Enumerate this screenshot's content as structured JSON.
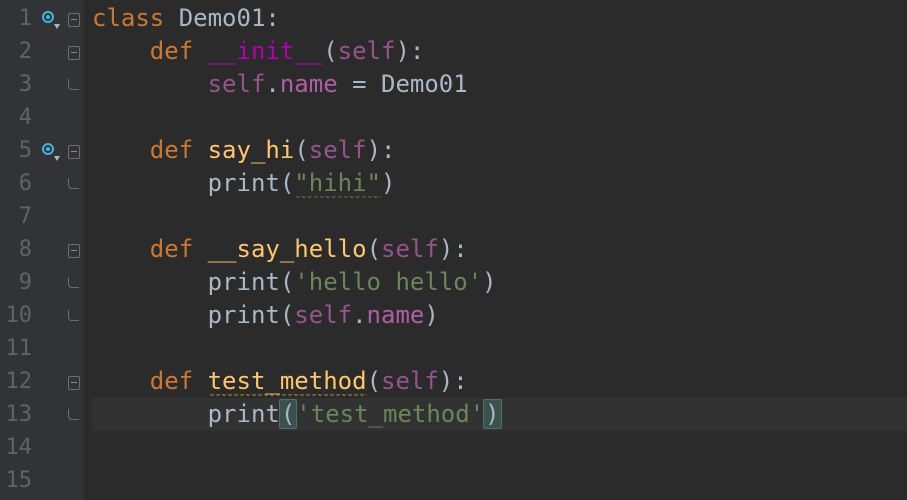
{
  "gutter": {
    "numbers": [
      "1",
      "2",
      "3",
      "4",
      "5",
      "6",
      "7",
      "8",
      "9",
      "10",
      "11",
      "12",
      "13",
      "14",
      "15"
    ],
    "override_lines": [
      1,
      5
    ],
    "fold_minus_lines": [
      1,
      2,
      5,
      8,
      12
    ],
    "fold_end_lines": [
      3,
      6,
      9,
      10,
      13
    ]
  },
  "code": {
    "l1": {
      "kw": "class",
      "cls": "Demo01",
      "colon": ":"
    },
    "l2": {
      "kw": "def",
      "name": "__init__",
      "lp": "(",
      "self": "self",
      "rp": ")",
      "colon": ":"
    },
    "l3": {
      "self": "self",
      "dot": ".",
      "attr": "name",
      "eq": " = ",
      "val": "Demo01"
    },
    "l5": {
      "kw": "def",
      "name": "say_hi",
      "lp": "(",
      "self": "self",
      "rp": ")",
      "colon": ":"
    },
    "l6": {
      "call": "print",
      "lp": "(",
      "str": "\"hihi\"",
      "rp": ")"
    },
    "l8": {
      "kw": "def",
      "name": "__say_hello",
      "lp": "(",
      "self": "self",
      "rp": ")",
      "colon": ":"
    },
    "l9": {
      "call": "print",
      "lp": "(",
      "str": "'hello hello'",
      "rp": ")"
    },
    "l10": {
      "call": "print",
      "lp": "(",
      "self": "self",
      "dot": ".",
      "attr": "name",
      "rp": ")"
    },
    "l12": {
      "kw": "def",
      "name": "test_method",
      "lp": "(",
      "self": "self",
      "rp": ")",
      "colon": ":"
    },
    "l13": {
      "call": "print",
      "lp": "(",
      "str": "'test_method'",
      "rp": ")"
    }
  }
}
